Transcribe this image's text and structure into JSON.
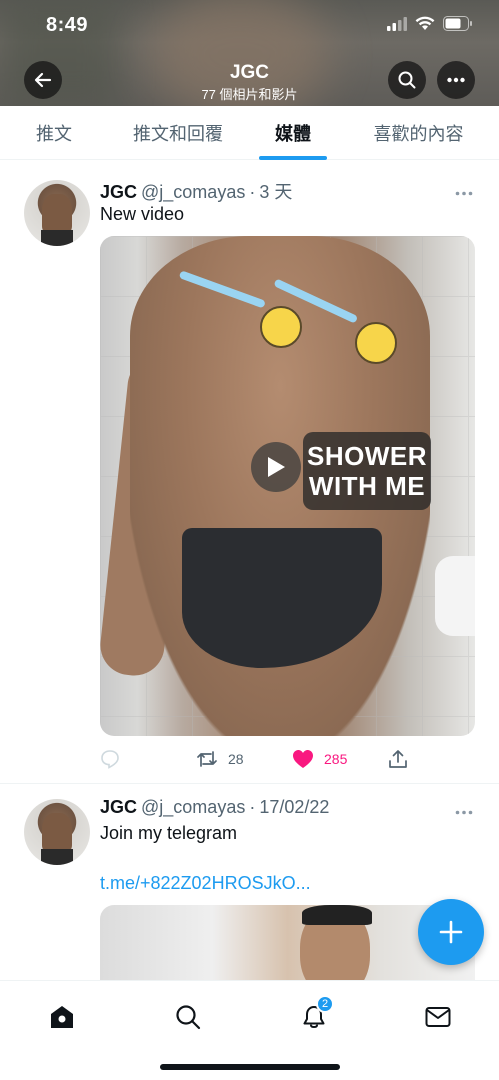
{
  "status_bar": {
    "time": "8:49"
  },
  "header": {
    "title": "JGC",
    "subtitle": "77 個相片和影片"
  },
  "tabs": [
    {
      "label": "推文",
      "active": false
    },
    {
      "label": "推文和回覆",
      "active": false
    },
    {
      "label": "媒體",
      "active": true
    },
    {
      "label": "喜歡的內容",
      "active": false
    }
  ],
  "tweets": [
    {
      "name": "JGC",
      "handle": "@j_comayas",
      "separator": "·",
      "time": "3 天",
      "text": "New video",
      "media": {
        "type": "video",
        "overlay_text_line1": "SHOWER",
        "overlay_text_line2": "WITH ME"
      },
      "retweets": "28",
      "likes": "285",
      "liked": true
    },
    {
      "name": "JGC",
      "handle": "@j_comayas",
      "separator": "·",
      "time": "17/02/22",
      "text": "Join my telegram",
      "link": "t.me/+822Z02HROSJkO..."
    }
  ],
  "notifications_badge": "2",
  "colors": {
    "accent": "#1d9bf0",
    "like": "#f91880",
    "text_secondary": "#536471"
  },
  "icons": [
    "back-arrow-icon",
    "search-icon",
    "more-icon",
    "play-icon",
    "reply-icon",
    "retweet-icon",
    "heart-icon",
    "share-icon",
    "compose-plus-icon",
    "home-icon",
    "explore-search-icon",
    "bell-icon",
    "mail-icon"
  ]
}
